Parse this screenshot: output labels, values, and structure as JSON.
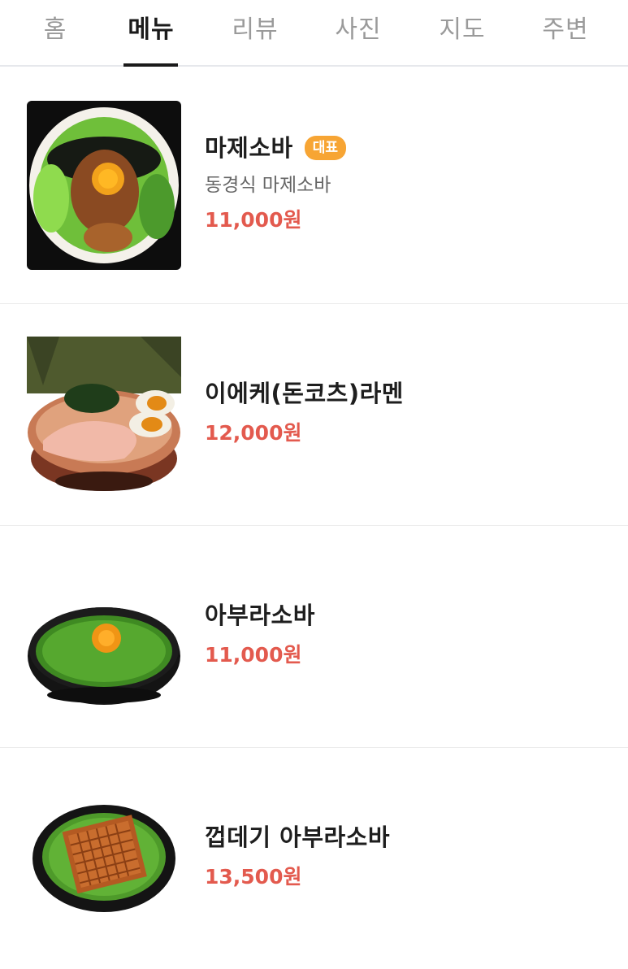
{
  "tabs": [
    {
      "label": "홈",
      "active": false
    },
    {
      "label": "메뉴",
      "active": true
    },
    {
      "label": "리뷰",
      "active": false
    },
    {
      "label": "사진",
      "active": false
    },
    {
      "label": "지도",
      "active": false
    },
    {
      "label": "주변",
      "active": false
    }
  ],
  "menu_items": [
    {
      "name": "마제소바",
      "badge": "대표",
      "description": "동경식 마제소바",
      "price": "11,000원",
      "image_icon": "mazesoba-bowl-photo"
    },
    {
      "name": "이에케(돈코츠)라멘",
      "badge": "",
      "description": "",
      "price": "12,000원",
      "image_icon": "ramen-bowl-photo"
    },
    {
      "name": "아부라소바",
      "badge": "",
      "description": "",
      "price": "11,000원",
      "image_icon": "aburasoba-bowl-photo"
    },
    {
      "name": "껍데기 아부라소바",
      "badge": "",
      "description": "",
      "price": "13,500원",
      "image_icon": "pork-skin-aburasoba-bowl-photo"
    }
  ],
  "colors": {
    "price": "#e35a4e",
    "badge": "#f7a534",
    "active_tab": "#1a1a1a",
    "inactive_tab": "#9a9a9a"
  }
}
